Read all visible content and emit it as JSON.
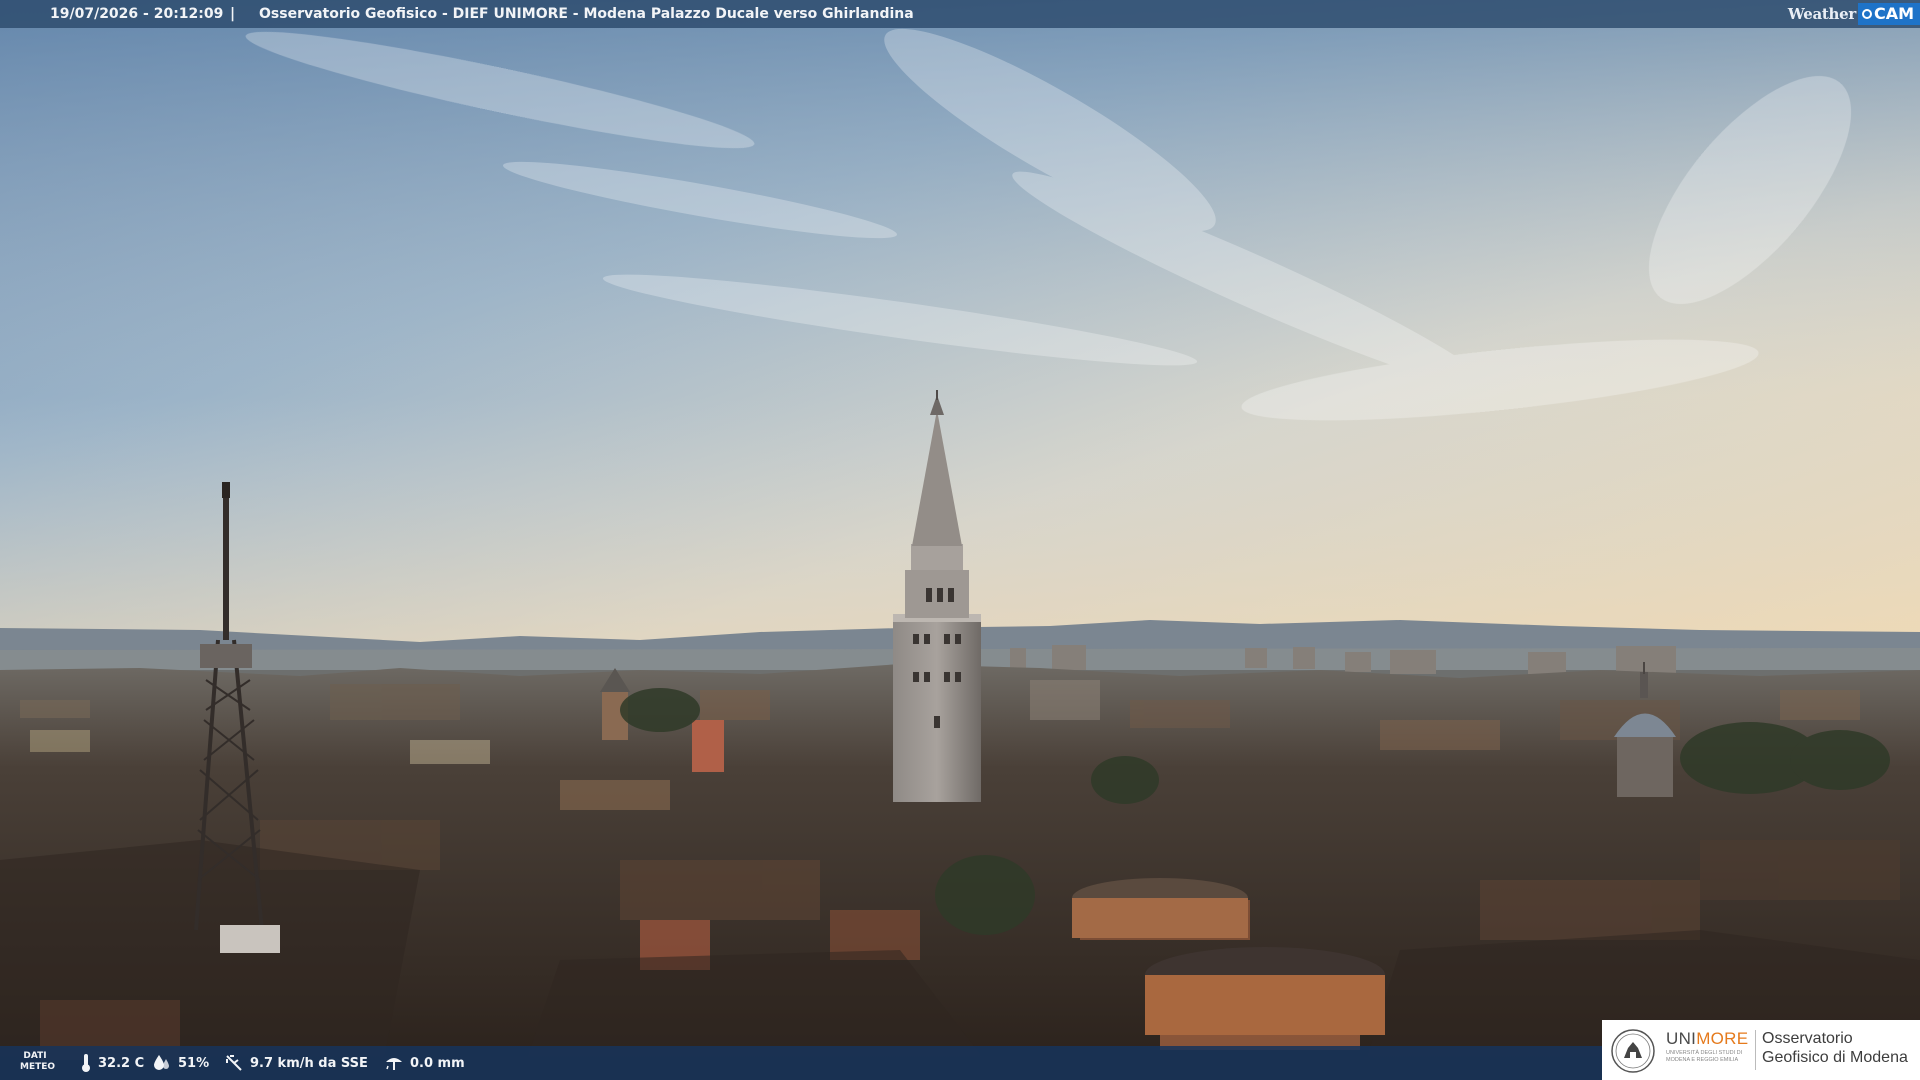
{
  "header": {
    "timestamp": "19/07/2026 - 20:12:09",
    "separator": "|",
    "title": "Osservatorio Geofisico - DIEF UNIMORE - Modena Palazzo Ducale verso Ghirlandina",
    "logo_weather": "Weather",
    "logo_cam": "CAM"
  },
  "weather": {
    "label": "DATI METEO",
    "temperature": "32.2 C",
    "humidity": "51%",
    "wind": "9.7 km/h da SSE",
    "rain": "0.0 mm"
  },
  "footer_logo": {
    "uni_prefix": "UNI",
    "uni_suffix": "MORE",
    "uni_subtitle": "UNIVERSITÀ DEGLI STUDI DI MODENA E REGGIO EMILIA",
    "observatory": "Osservatorio Geofisico di Modena"
  },
  "colors": {
    "bar_top": "#2c4a6c",
    "bar_bottom": "#16345c",
    "accent_orange": "#e57a1c",
    "cam_blue": "#1e73c8"
  },
  "icons": [
    "thermometer-icon",
    "humidity-icon",
    "wind-icon",
    "rain-gauge-icon",
    "university-seal-icon"
  ]
}
